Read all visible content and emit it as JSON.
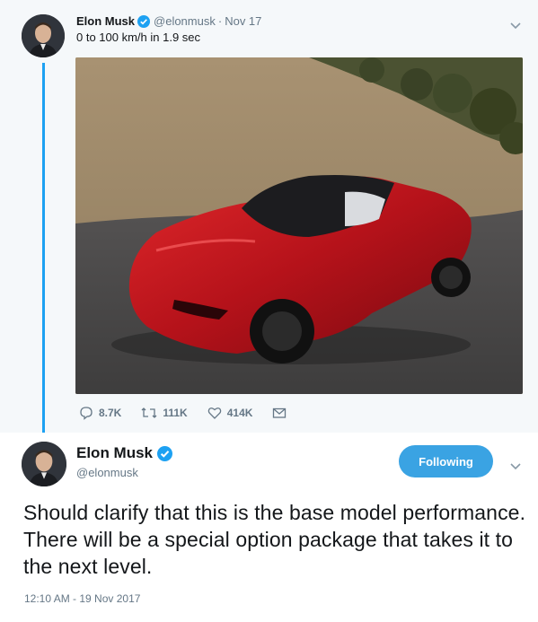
{
  "parent_tweet": {
    "author_name": "Elon Musk",
    "handle": "@elonmusk",
    "separator": "·",
    "date": "Nov 17",
    "text": "0 to 100 km/h in 1.9 sec",
    "media_icon": "photo-red-roadster",
    "actions": {
      "replies": "8.7K",
      "retweets": "111K",
      "likes": "414K"
    }
  },
  "main_tweet": {
    "author_name": "Elon Musk",
    "handle": "@elonmusk",
    "follow_label": "Following",
    "text": "Should clarify that this is the base model performance. There will be a special option package that takes it to the next level.",
    "timestamp": "12:10 AM - 19 Nov 2017"
  },
  "colors": {
    "accent": "#1da1f2",
    "follow_button": "#3aa3e3",
    "muted": "#657786",
    "background": "#e6ecf0"
  }
}
